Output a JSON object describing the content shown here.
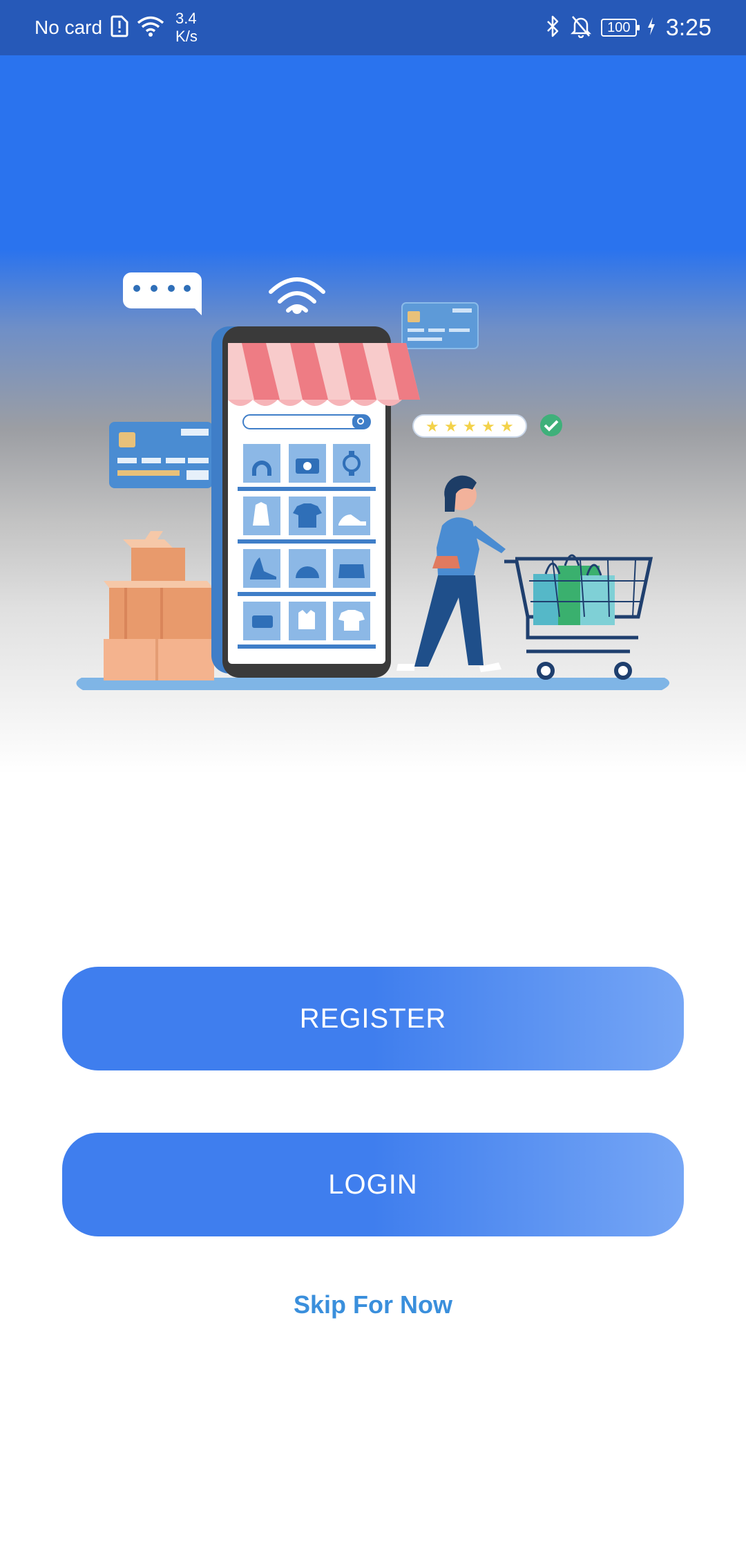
{
  "status_bar": {
    "carrier": "No card",
    "speed_value": "3.4",
    "speed_unit": "K/s",
    "battery": "100",
    "time": "3:25",
    "icons": [
      "sim-alert-icon",
      "wifi-icon",
      "bluetooth-icon",
      "mute-bell-icon",
      "battery-icon",
      "charging-icon"
    ]
  },
  "hero": {
    "illustration": "online-shopping-illustration",
    "rating_stars": 5
  },
  "actions": {
    "register_label": "REGISTER",
    "login_label": "LOGIN",
    "skip_label": "Skip For Now"
  },
  "colors": {
    "primary": "#3f7eee",
    "status_bar": "#2659b8",
    "skip_link": "#3a8fdc"
  }
}
